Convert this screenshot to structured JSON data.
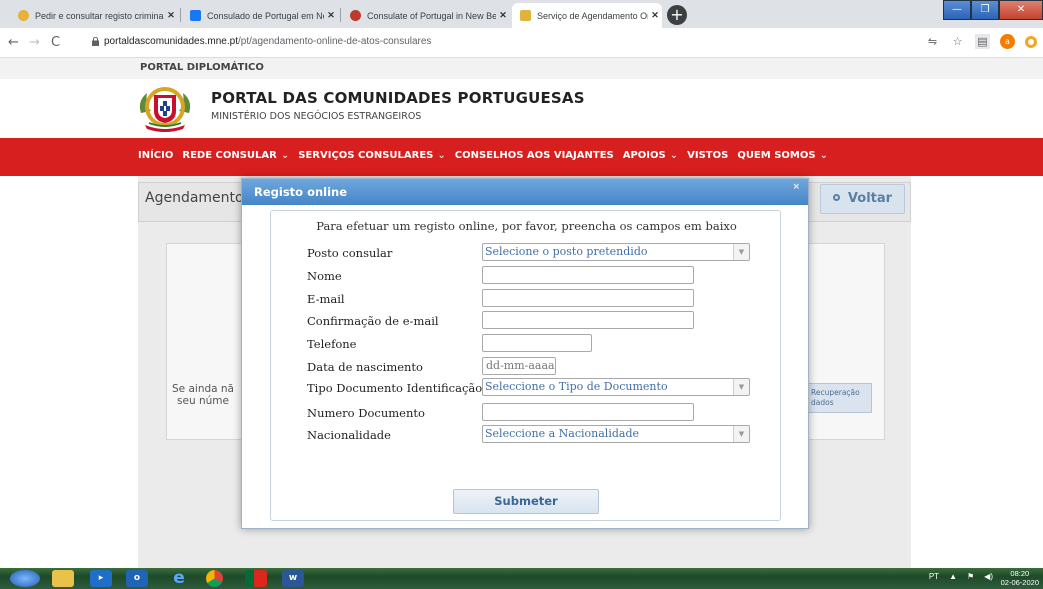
{
  "browser": {
    "tabs": [
      {
        "label": "Pedir e consultar registo criminal",
        "favicon_color": "#e8b13a"
      },
      {
        "label": "Consulado de Portugal em New",
        "favicon_color": "#1877f2"
      },
      {
        "label": "Consulate of Portugal in New Be",
        "favicon_color": "#c0392b"
      },
      {
        "label": "Serviço de Agendamento Online",
        "favicon_color": "#e0b43a",
        "active": true
      }
    ],
    "tab_close": "✕",
    "new_tab": "+",
    "url_domain": "portaldascomunidades.mne.pt",
    "url_path": "/pt/agendamento-online-de-atos-consulares",
    "window_min": "—",
    "window_max": "❐",
    "window_close": "✕"
  },
  "site": {
    "top_label": "PORTAL DIPLOMÁTICO",
    "title": "PORTAL DAS COMUNIDADES PORTUGUESAS",
    "subtitle": "MINISTÉRIO DOS NEGÓCIOS ESTRANGEIROS",
    "nav": [
      {
        "label": "INÍCIO",
        "dropdown": false
      },
      {
        "label": "REDE CONSULAR",
        "dropdown": true
      },
      {
        "label": "SERVIÇOS CONSULARES",
        "dropdown": true
      },
      {
        "label": "CONSELHOS AOS VIAJANTES",
        "dropdown": false
      },
      {
        "label": "APOIOS",
        "dropdown": true
      },
      {
        "label": "VISTOS",
        "dropdown": false
      },
      {
        "label": "QUEM SOMOS",
        "dropdown": true
      }
    ],
    "nav_chevron": "⌄",
    "brand_red": "#d71f1f"
  },
  "main": {
    "heading": "Agendamentos",
    "back_button": "Voltar",
    "left_note_line1": "Se ainda nã",
    "left_note_line2": "seu núme",
    "recovery_line1": "Recuperação",
    "recovery_line2": "dados"
  },
  "modal": {
    "title": "Registo online",
    "close": "×",
    "intro": "Para efetuar um registo online, por favor, preencha os campos em baixo",
    "fields": {
      "posto": {
        "label": "Posto consular",
        "value": "Selecione o posto pretendido"
      },
      "nome": {
        "label": "Nome",
        "value": ""
      },
      "email": {
        "label": "E-mail",
        "value": ""
      },
      "email_confirm": {
        "label": "Confirmação de e-mail",
        "value": ""
      },
      "telefone": {
        "label": "Telefone",
        "value": ""
      },
      "nascimento": {
        "label": "Data de nascimento",
        "placeholder": "dd-mm-aaaa"
      },
      "tipo_doc": {
        "label": "Tipo Documento Identificação",
        "value": "Seleccione o Tipo de Documento"
      },
      "numero_doc": {
        "label": "Numero Documento",
        "value": ""
      },
      "nacionalidade": {
        "label": "Nacionalidade",
        "value": "Seleccione a Nacionalidade"
      }
    },
    "submit": "Submeter",
    "select_arrow": "▼"
  },
  "taskbar": {
    "lang": "PT",
    "time": "08:20",
    "date": "02-06-2020"
  }
}
